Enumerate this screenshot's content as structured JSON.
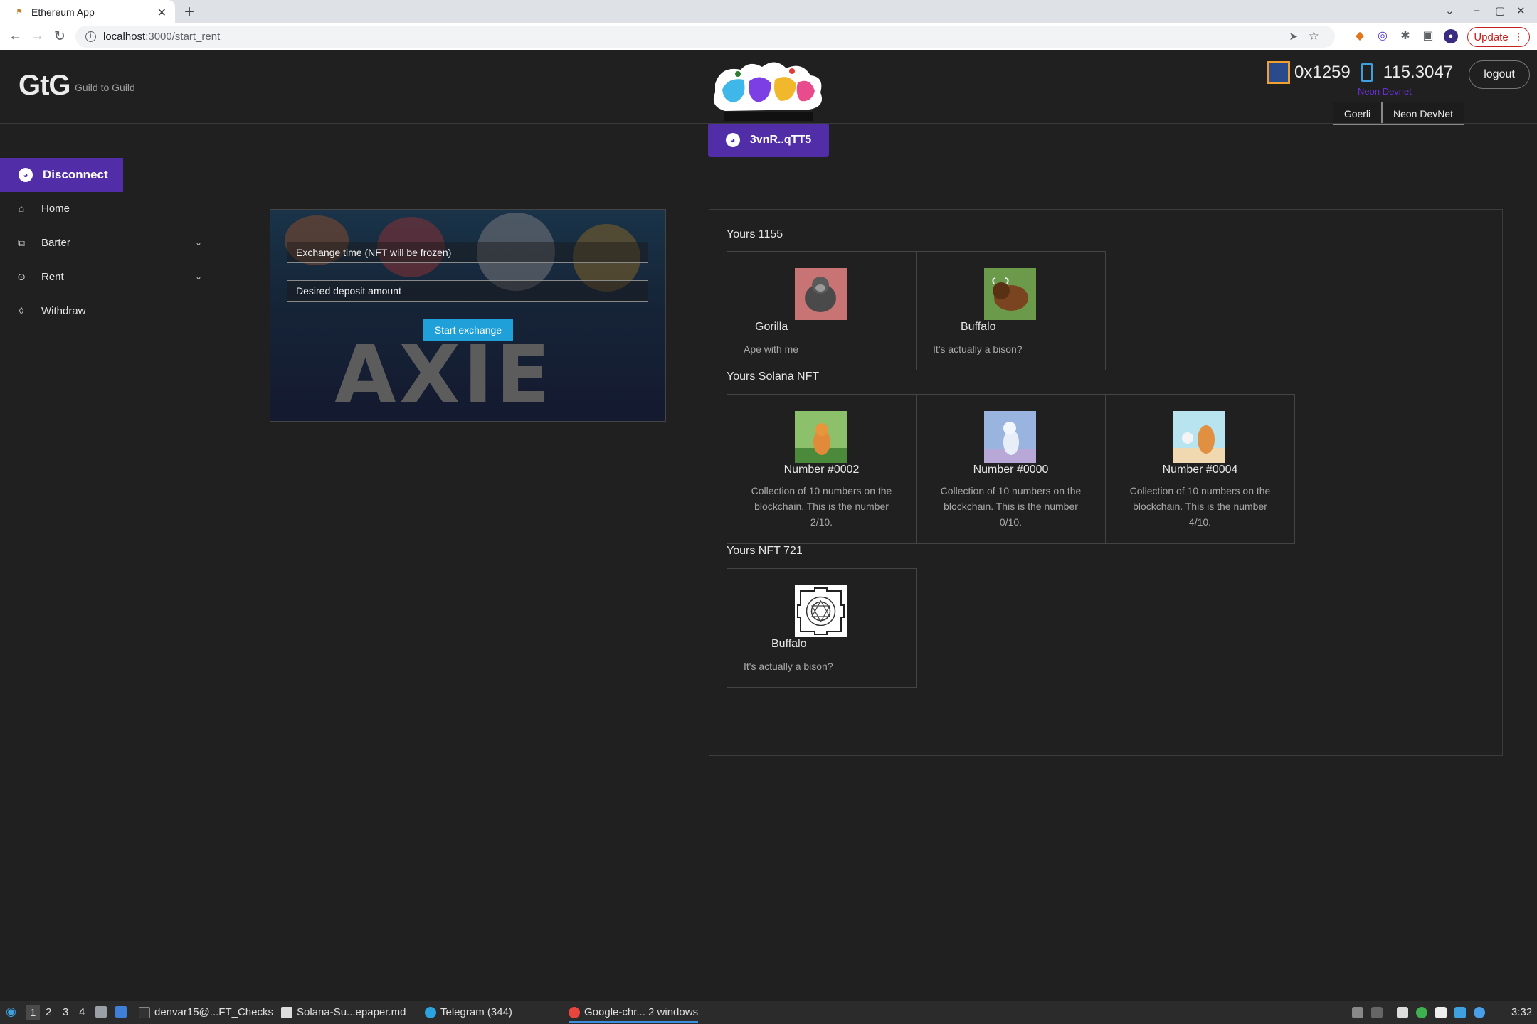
{
  "browser": {
    "tab_title": "Ethereum App",
    "url_host": "localhost",
    "url_path": ":3000/start_rent",
    "update_label": "Update"
  },
  "header": {
    "logo": "GtG",
    "logo_subtitle": "Guild to Guild",
    "wallet_label": "3vnR..qTT5",
    "account_id": "0x1259",
    "balance": "115.3047",
    "network_label": "Neon Devnet",
    "logout_label": "logout",
    "networks": [
      "Goerli",
      "Neon DevNet"
    ]
  },
  "sidebar": {
    "disconnect_label": "Disconnect",
    "items": [
      {
        "label": "Home",
        "icon": "home-icon",
        "expandable": false
      },
      {
        "label": "Barter",
        "icon": "barter-icon",
        "expandable": true
      },
      {
        "label": "Rent",
        "icon": "rent-icon",
        "expandable": true
      },
      {
        "label": "Withdraw",
        "icon": "withdraw-icon",
        "expandable": false
      }
    ]
  },
  "exchange_form": {
    "time_placeholder": "Exchange time (NFT will be frozen)",
    "deposit_placeholder": "Desired deposit amount",
    "start_label": "Start exchange"
  },
  "nfts": {
    "erc1155_title": "Yours 1155",
    "erc1155": [
      {
        "name": "Gorilla",
        "desc": "Ape with me"
      },
      {
        "name": "Buffalo",
        "desc": "It's actually a bison?"
      }
    ],
    "solana_title": "Yours Solana NFT",
    "solana": [
      {
        "name": "Number #0002",
        "desc": "Collection of 10 numbers on the blockchain. This is the number 2/10."
      },
      {
        "name": "Number #0000",
        "desc": "Collection of 10 numbers on the blockchain. This is the number 0/10."
      },
      {
        "name": "Number #0004",
        "desc": "Collection of 10 numbers on the blockchain. This is the number 4/10."
      }
    ],
    "erc721_title": "Yours NFT 721",
    "erc721": [
      {
        "name": "Buffalo",
        "desc": "It's actually a bison?"
      }
    ]
  },
  "taskbar": {
    "workspaces": [
      "1",
      "2",
      "3",
      "4"
    ],
    "apps": [
      "denvar15@...FT_Checks",
      "Solana-Su...epaper.md",
      "Telegram (344)",
      "Google-chr... 2 windows"
    ],
    "clock": "3:32"
  }
}
